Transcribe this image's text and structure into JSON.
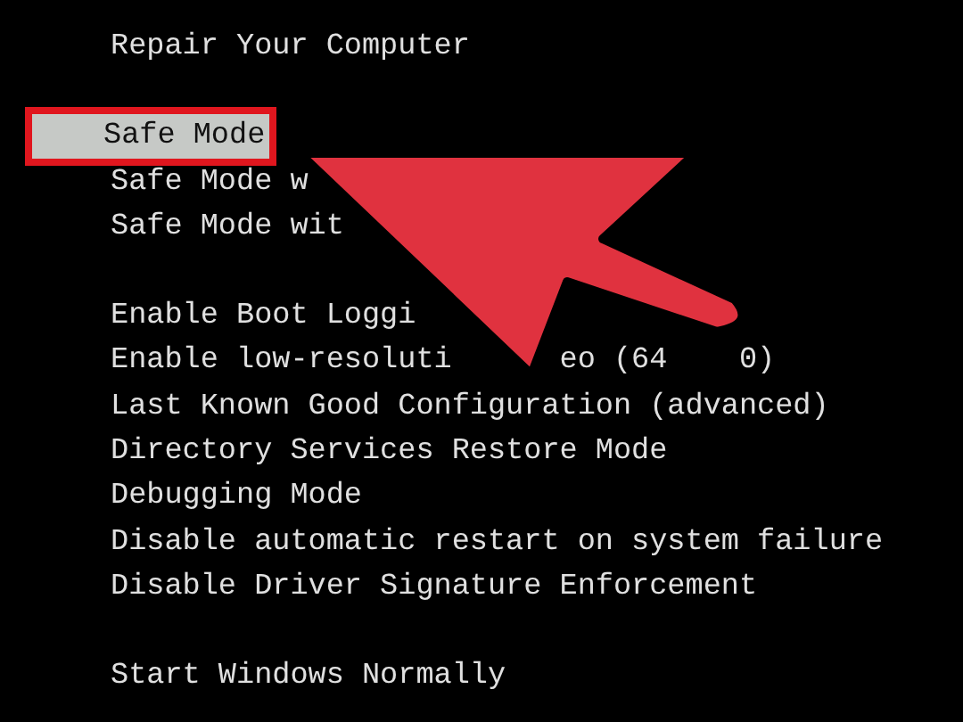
{
  "boot_menu": {
    "groups": [
      [
        {
          "parts": [
            "Repair Your Computer"
          ],
          "selected": false
        }
      ],
      [
        {
          "parts": [
            "Safe Mode"
          ],
          "selected": true
        },
        {
          "parts": [
            "Safe Mode w"
          ],
          "selected": false
        },
        {
          "parts": [
            "Safe Mode wit"
          ],
          "selected": false
        }
      ],
      [
        {
          "parts": [
            "Enable Boot Loggi"
          ],
          "selected": false
        },
        {
          "parts": [
            "Enable low-resoluti",
            "eo (64",
            "0)"
          ],
          "selected": false
        },
        {
          "parts": [
            "Last Known Good Configuration (advanced)"
          ],
          "selected": false
        },
        {
          "parts": [
            "Directory Services Restore Mode"
          ],
          "selected": false
        },
        {
          "parts": [
            "Debugging Mode"
          ],
          "selected": false
        },
        {
          "parts": [
            "Disable automatic restart on system failure"
          ],
          "selected": false
        },
        {
          "parts": [
            "Disable Driver Signature Enforcement"
          ],
          "selected": false
        }
      ],
      [
        {
          "parts": [
            "Start Windows Normally"
          ],
          "selected": false
        }
      ]
    ]
  }
}
